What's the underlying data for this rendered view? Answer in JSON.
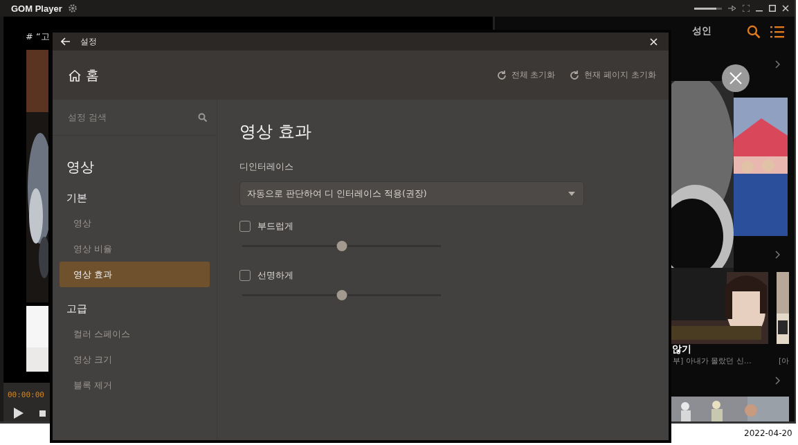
{
  "app": {
    "title": "GOM Player",
    "volume": {
      "level": 0.8
    }
  },
  "player": {
    "caption": "# “고",
    "time": "00:00:00"
  },
  "feed": {
    "nav_item": "성인",
    "card_title": "않기",
    "card_subtitle": "부] 아내가 몰랐던 신…",
    "card_2_subtitle": "[아",
    "date": "2022-04-20"
  },
  "settings": {
    "title": "설정",
    "home": "홈",
    "reset_buttons": [
      "전체 초기화",
      "현재 페이지 초기화"
    ],
    "search": {
      "placeholder": "설정 검색"
    },
    "category": "영상",
    "groups": [
      {
        "label": "기본",
        "items": [
          {
            "label": "영상",
            "selected": false
          },
          {
            "label": "영상 비율",
            "selected": false
          },
          {
            "label": "영상 효과",
            "selected": true
          }
        ]
      },
      {
        "label": "고급",
        "items": [
          {
            "label": "컬러 스페이스",
            "selected": false
          },
          {
            "label": "영상 크기",
            "selected": false
          },
          {
            "label": "블록 제거",
            "selected": false
          }
        ]
      }
    ],
    "page_title": "영상 효과",
    "deinterlace": {
      "label": "디인터레이스",
      "value": "자동으로 판단하여 디 인터레이스 적용(권장)"
    },
    "options": [
      {
        "label": "부드럽게",
        "checked": false,
        "level": 0.5
      },
      {
        "label": "선명하게",
        "checked": false,
        "level": 0.5
      }
    ]
  }
}
